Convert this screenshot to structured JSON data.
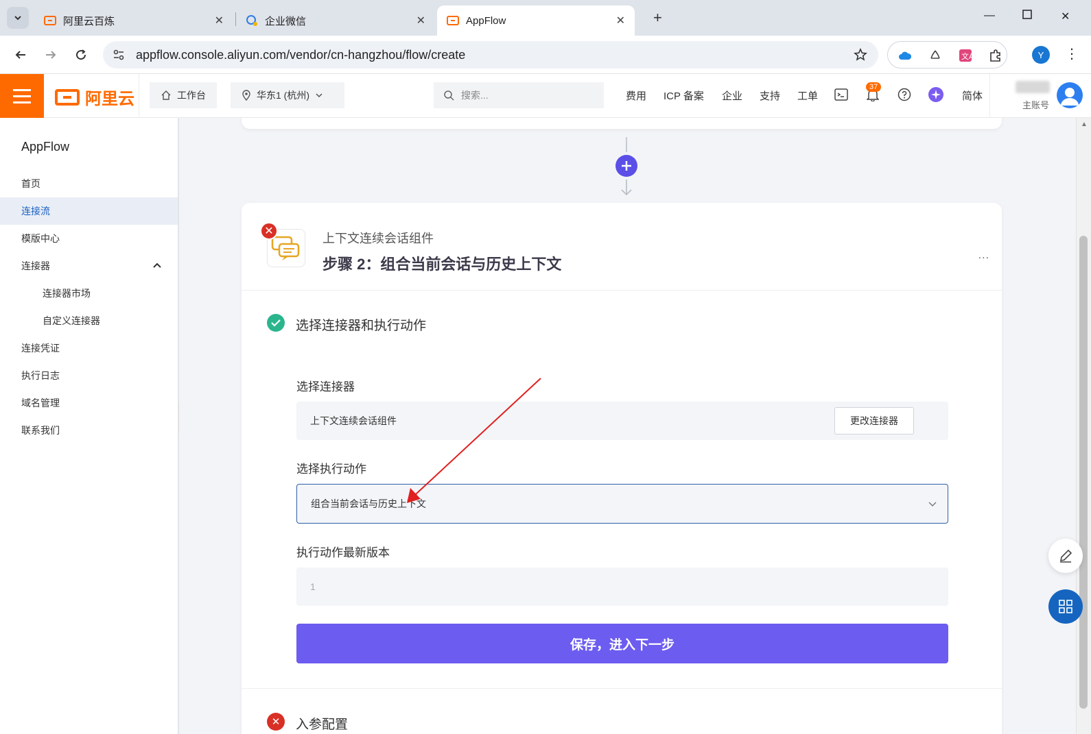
{
  "browser": {
    "tabs": [
      {
        "title": "阿里云百炼"
      },
      {
        "title": "企业微信"
      },
      {
        "title": "AppFlow"
      }
    ],
    "url": "appflow.console.aliyun.com/vendor/cn-hangzhou/flow/create",
    "profile_initial": "Y"
  },
  "header": {
    "logo_text": "阿里云",
    "workbench": "工作台",
    "region": "华东1 (杭州)",
    "search_placeholder": "搜索...",
    "links": [
      "费用",
      "ICP 备案",
      "企业",
      "支持",
      "工单"
    ],
    "notification_count": "37",
    "language": "简体",
    "account_label": "主账号"
  },
  "sidebar": {
    "title": "AppFlow",
    "items": [
      {
        "label": "首页"
      },
      {
        "label": "连接流"
      },
      {
        "label": "模版中心"
      },
      {
        "label": "连接器"
      },
      {
        "label": "连接器市场"
      },
      {
        "label": "自定义连接器"
      },
      {
        "label": "连接凭证"
      },
      {
        "label": "执行日志"
      },
      {
        "label": "域名管理"
      },
      {
        "label": "联系我们"
      }
    ]
  },
  "step": {
    "subtitle": "上下文连续会话组件",
    "title": "步骤 2：组合当前会话与历史上下文",
    "more": "...",
    "section_title": "选择连接器和执行动作",
    "connector_label": "选择连接器",
    "connector_value": "上下文连续会话组件",
    "change_connector": "更改连接器",
    "action_label": "选择执行动作",
    "action_value": "组合当前会话与历史上下文",
    "version_label": "执行动作最新版本",
    "version_value": "1",
    "save_button": "保存，进入下一步",
    "next_section_title": "入参配置"
  },
  "colors": {
    "brand": "#ff6a00",
    "primary_button": "#6c5cf0",
    "success": "#2bb58d",
    "error": "#d93025",
    "annotation_arrow": "#e02020"
  }
}
